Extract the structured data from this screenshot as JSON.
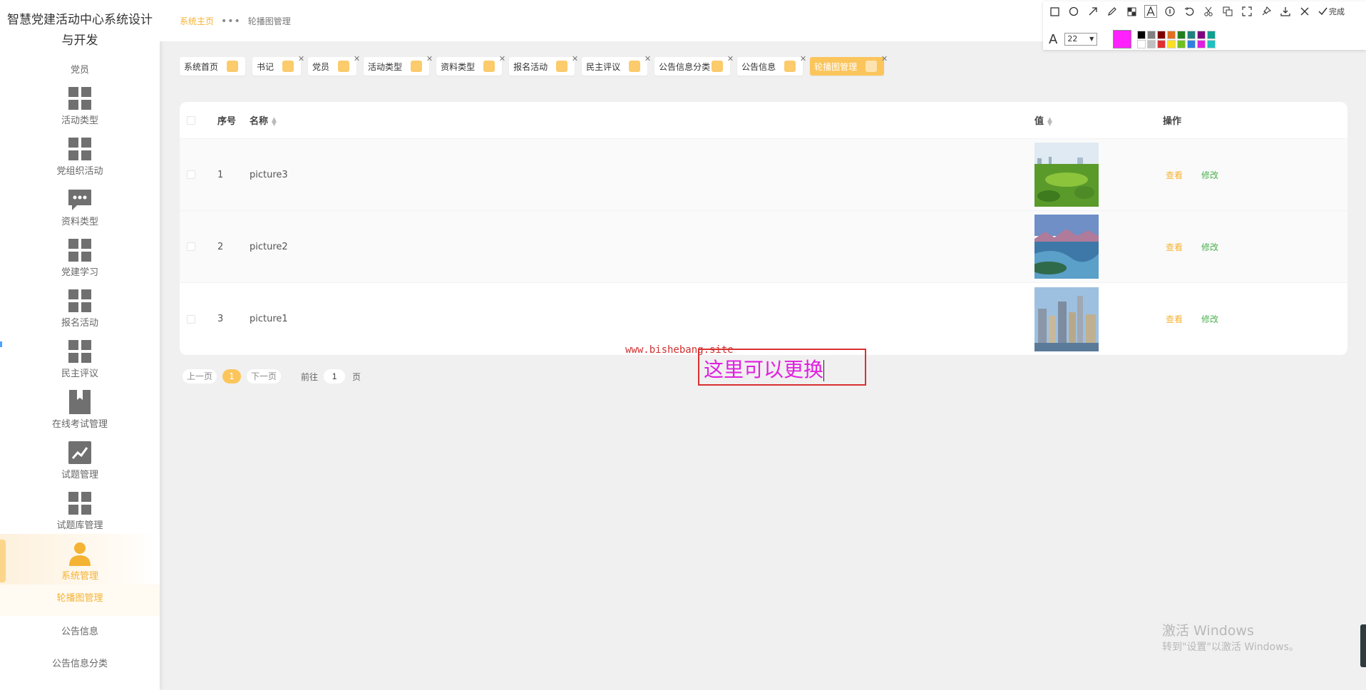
{
  "app": {
    "system_title": "智慧党建活动中心系统设计与开发"
  },
  "sidebar": {
    "section_label": "党员",
    "items": [
      {
        "label": "活动类型",
        "icon": "grid-icon"
      },
      {
        "label": "党组织活动",
        "icon": "grid-icon"
      },
      {
        "label": "资料类型",
        "icon": "chat-icon"
      },
      {
        "label": "党建学习",
        "icon": "grid-icon"
      },
      {
        "label": "报名活动",
        "icon": "grid-icon"
      },
      {
        "label": "民主评议",
        "icon": "grid-icon"
      },
      {
        "label": "在线考试管理",
        "icon": "book-icon"
      },
      {
        "label": "试题管理",
        "icon": "chart-icon"
      },
      {
        "label": "试题库管理",
        "icon": "grid-icon"
      },
      {
        "label": "系统管理",
        "icon": "user-icon",
        "active": true
      }
    ],
    "sub_items": [
      {
        "label": "轮播图管理",
        "active": true
      },
      {
        "label": "公告信息"
      },
      {
        "label": "公告信息分类"
      }
    ]
  },
  "breadcrumb": {
    "home": "系统主页",
    "separator": "•••",
    "current": "轮播图管理"
  },
  "tabs": [
    {
      "label": "系统首页",
      "closable": false
    },
    {
      "label": "书记",
      "closable": true
    },
    {
      "label": "党员",
      "closable": true
    },
    {
      "label": "活动类型",
      "closable": true
    },
    {
      "label": "资料类型",
      "closable": true
    },
    {
      "label": "报名活动",
      "closable": true
    },
    {
      "label": "民主评议",
      "closable": true
    },
    {
      "label": "公告信息分类",
      "closable": true
    },
    {
      "label": "公告信息",
      "closable": true
    },
    {
      "label": "轮播图管理",
      "closable": true,
      "active": true
    }
  ],
  "table": {
    "headers": {
      "index": "序号",
      "name": "名称",
      "value": "值",
      "ops": "操作"
    },
    "rows": [
      {
        "index": "1",
        "name": "picture3",
        "thumb": "park-image"
      },
      {
        "index": "2",
        "name": "picture2",
        "thumb": "lake-image"
      },
      {
        "index": "3",
        "name": "picture1",
        "thumb": "city-image"
      }
    ],
    "view_label": "查看",
    "edit_label": "修改"
  },
  "pagination": {
    "prev": "上一页",
    "current": "1",
    "next": "下一页",
    "goto_label": "前往",
    "goto_value": "1",
    "page_unit": "页"
  },
  "overlay": {
    "watermark": "www.bishebang.site",
    "annotation_text": "这里可以更换"
  },
  "windows_activation": {
    "line1": "激活 Windows",
    "line2": "转到\"设置\"以激活 Windows。"
  },
  "screenshot_tool": {
    "done_label": "完成",
    "font_size": "22",
    "current_color": "#ff22ff",
    "palette": [
      "#000000",
      "#808080",
      "#800000",
      "#e07020",
      "#208020",
      "#208080",
      "#800080",
      "#10a090",
      "#ffffff",
      "#c0c0c0",
      "#e03030",
      "#ffe020",
      "#70c020",
      "#3080e0",
      "#e020e0",
      "#20c0c0"
    ]
  },
  "colors": {
    "accent": "#f5b333",
    "edit_green": "#4caf50"
  }
}
